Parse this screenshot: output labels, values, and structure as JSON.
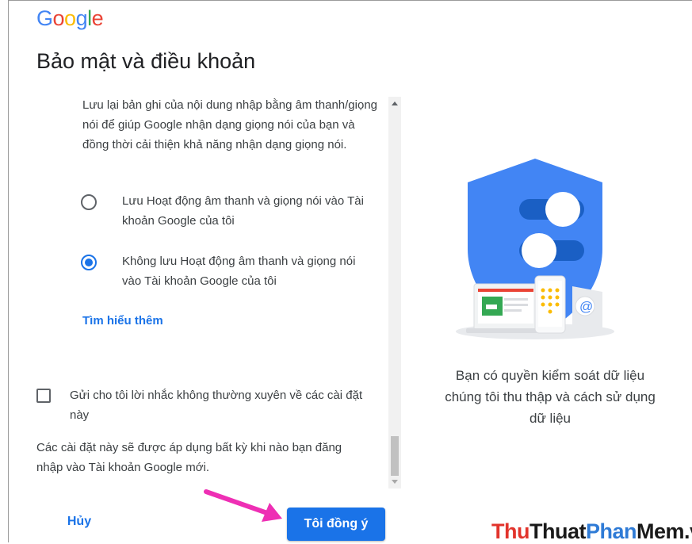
{
  "logo": {
    "letters": [
      "G",
      "o",
      "o",
      "g",
      "l",
      "e"
    ],
    "colors": [
      "#4285f4",
      "#ea4335",
      "#fbbc05",
      "#4285f4",
      "#34a853",
      "#ea4335"
    ]
  },
  "page": {
    "title": "Bảo mật và điều khoản"
  },
  "voice": {
    "intro": "Lưu lại bản ghi của nội dung nhập bằng âm thanh/giọng nói để giúp Google nhận dạng giọng nói của bạn và đồng thời cải thiện khả năng nhận dạng giọng nói.",
    "options": [
      {
        "label": "Lưu Hoạt động âm thanh và giọng nói vào Tài khoản Google của tôi",
        "checked": false
      },
      {
        "label": "Không lưu Hoạt động âm thanh và giọng nói vào Tài khoản Google của tôi",
        "checked": true
      }
    ],
    "learn_more": "Tìm hiểu thêm"
  },
  "reminder": {
    "label": "Gửi cho tôi lời nhắc không thường xuyên về các cài đặt này",
    "checked": false
  },
  "footnote": "Các cài đặt này sẽ được áp dụng bất kỳ khi nào bạn đăng nhập vào Tài khoản Google mới.",
  "illustration": {
    "caption": "Bạn có quyền kiểm soát dữ liệu chúng tôi thu thập và cách sử dụng dữ liệu"
  },
  "buttons": {
    "cancel": "Hủy",
    "agree": "Tôi đồng ý"
  },
  "watermark": {
    "parts": [
      "Thu",
      "Thuat",
      "Phan",
      "Mem",
      ".vn"
    ],
    "colors": [
      "#e2342c",
      "#1a1a1a",
      "#2f7bd6",
      "#1a1a1a",
      "#1a1a1a"
    ]
  },
  "colors": {
    "accent": "#1a73e8",
    "shield": "#4285f4",
    "arrow": "#ee2fb4"
  }
}
